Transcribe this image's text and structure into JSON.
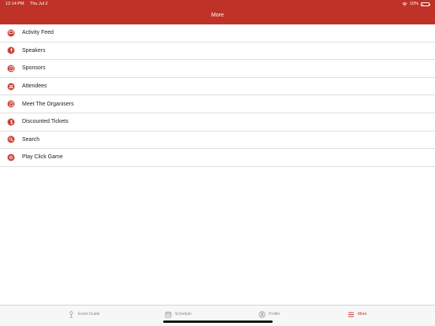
{
  "status": {
    "time": "12:14 PM",
    "date": "Thu Jul 2",
    "battery": "10%"
  },
  "header": {
    "title": "More"
  },
  "menu": [
    {
      "label": "Activity Feed",
      "icon": "chat-icon"
    },
    {
      "label": "Speakers",
      "icon": "speaker-icon"
    },
    {
      "label": "Sponsors",
      "icon": "sponsor-icon"
    },
    {
      "label": "Attendees",
      "icon": "attendees-icon"
    },
    {
      "label": "Meet The Organisers",
      "icon": "organisers-icon"
    },
    {
      "label": "Discounted Tickets",
      "icon": "dollar-icon"
    },
    {
      "label": "Search",
      "icon": "search-icon"
    },
    {
      "label": "Play Click Game",
      "icon": "game-icon"
    }
  ],
  "tabs": [
    {
      "label": "Event Guide",
      "icon": "event-guide-icon"
    },
    {
      "label": "Schedule",
      "icon": "calendar-icon"
    },
    {
      "label": "Profile",
      "icon": "profile-icon"
    },
    {
      "label": "More",
      "icon": "menu-icon",
      "active": true
    }
  ],
  "colors": {
    "accent": "#bf3228",
    "tab_inactive": "#8a8a8a"
  }
}
